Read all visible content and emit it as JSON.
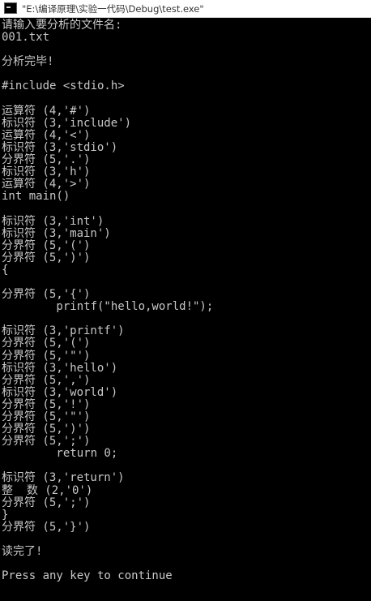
{
  "window": {
    "title": "\"E:\\编译原理\\实验一代码\\Debug\\test.exe\""
  },
  "console": {
    "lines": [
      "请输入要分析的文件名:",
      "001.txt",
      "",
      "分析完毕!",
      "",
      "#include <stdio.h>",
      "",
      "运算符 (4,'#')",
      "标识符 (3,'include')",
      "运算符 (4,'<')",
      "标识符 (3,'stdio')",
      "分界符 (5,'.')",
      "标识符 (3,'h')",
      "运算符 (4,'>')",
      "int main()",
      "",
      "标识符 (3,'int')",
      "标识符 (3,'main')",
      "分界符 (5,'(')",
      "分界符 (5,')')",
      "{",
      "",
      "分界符 (5,'{')",
      "        printf(\"hello,world!\");",
      "",
      "标识符 (3,'printf')",
      "分界符 (5,'(')",
      "分界符 (5,'\"')",
      "标识符 (3,'hello')",
      "分界符 (5,',')",
      "标识符 (3,'world')",
      "分界符 (5,'!')",
      "分界符 (5,'\"')",
      "分界符 (5,')')",
      "分界符 (5,';')",
      "        return 0;",
      "",
      "标识符 (3,'return')",
      "整  数 (2,'0')",
      "分界符 (5,';')",
      "}",
      "分界符 (5,'}')",
      "",
      "读完了!",
      "",
      "Press any key to continue"
    ]
  }
}
